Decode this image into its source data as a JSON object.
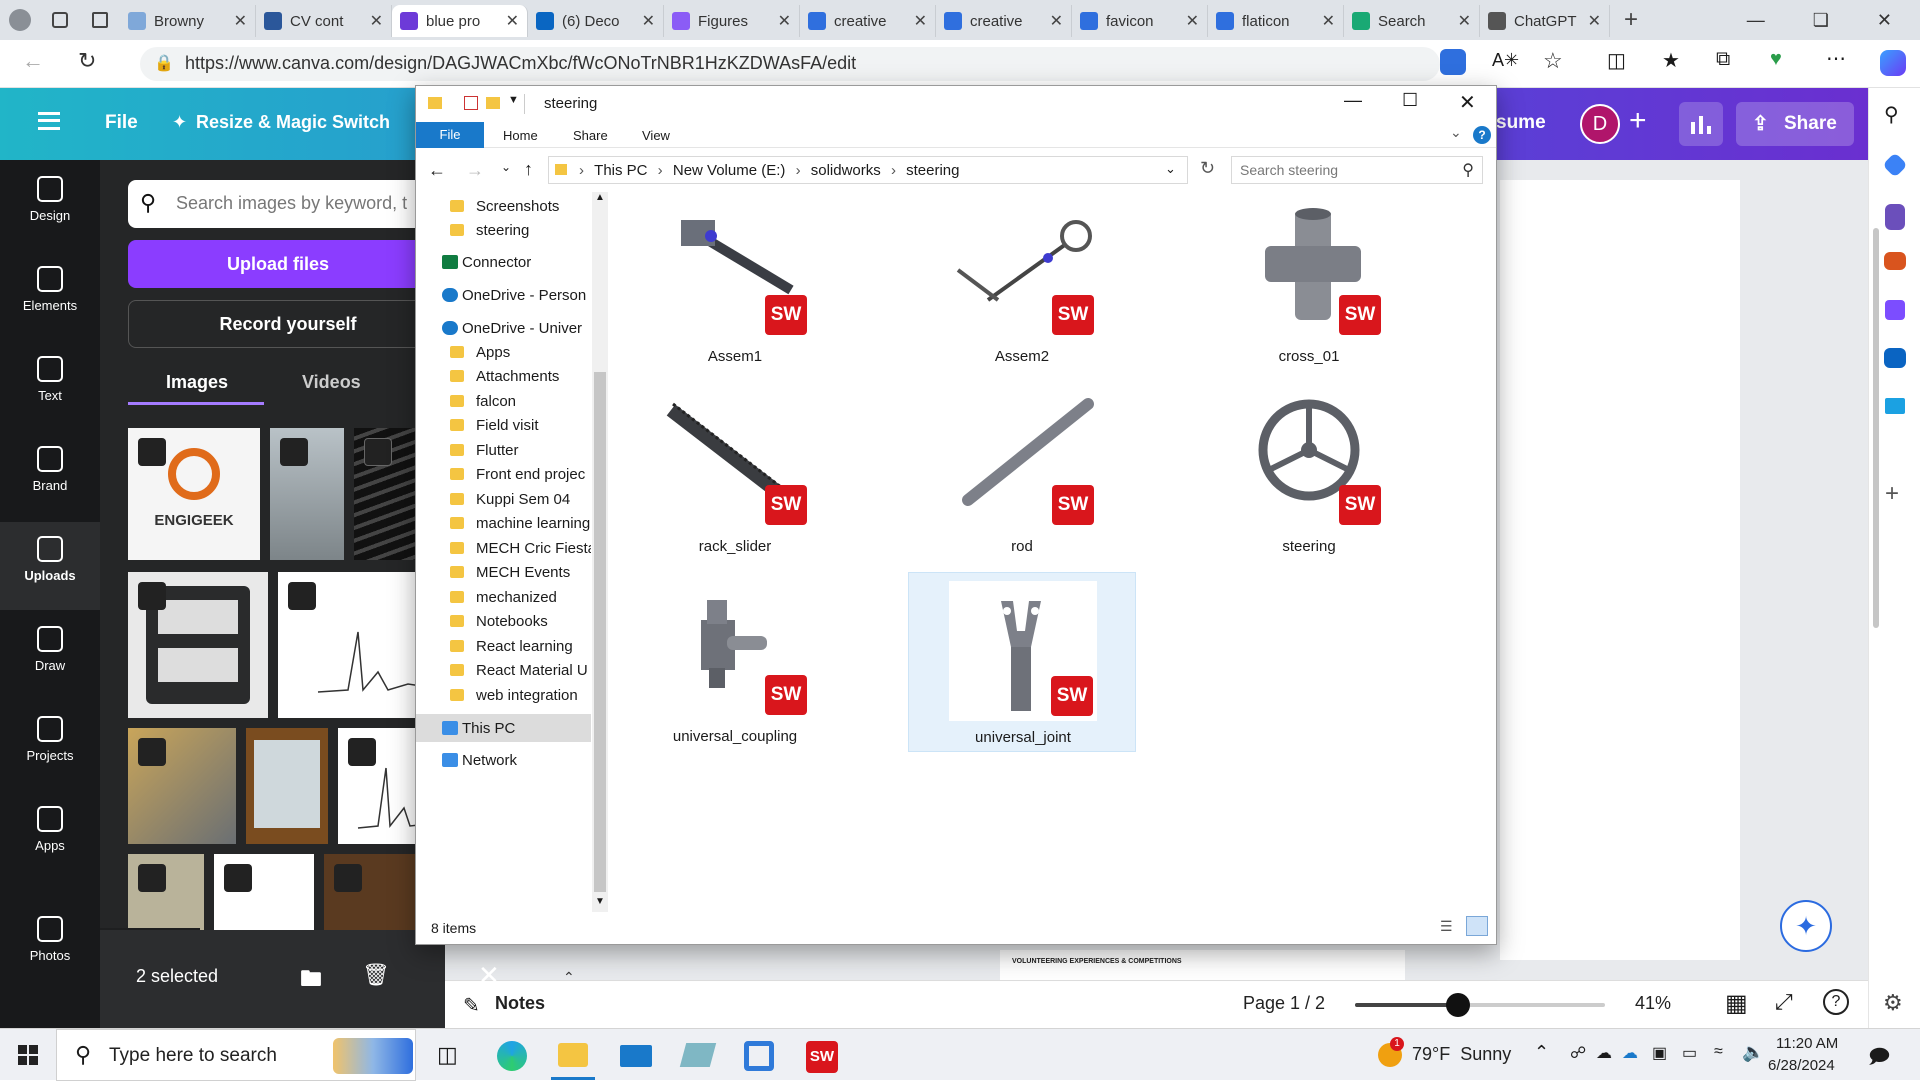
{
  "browser": {
    "tabs": [
      {
        "label": "Browny",
        "color": "#7fa8d9"
      },
      {
        "label": "CV cont",
        "color": "#2b579a"
      },
      {
        "label": "blue pro",
        "color": "#6d3ad8",
        "active": true
      },
      {
        "label": "(6) Deco",
        "color": "#0a66c2"
      },
      {
        "label": "Figures",
        "color": "#8b5cf6"
      },
      {
        "label": "creative",
        "color": "#2f6fde"
      },
      {
        "label": "creative",
        "color": "#2f6fde"
      },
      {
        "label": "favicon",
        "color": "#2f6fde"
      },
      {
        "label": "flaticon",
        "color": "#2f6fde"
      },
      {
        "label": "Search",
        "color": "#19a974"
      },
      {
        "label": "ChatGPT",
        "color": "#555555"
      }
    ],
    "url": "https://www.canva.com/design/DAGJWACmXbc/fWcONoTrNBR1HzKZDWAsFA/edit"
  },
  "canva": {
    "file_label": "File",
    "resize_label": "Resize & Magic Switch",
    "resume_label": "sume",
    "avatar": "D",
    "share_label": "Share",
    "nav": [
      "Design",
      "Elements",
      "Text",
      "Brand",
      "Uploads",
      "Draw",
      "Projects",
      "Apps",
      "Photos"
    ],
    "search_placeholder": "Search images by keyword, t",
    "upload_label": "Upload files",
    "record_label": "Record yourself",
    "tab_images": "Images",
    "tab_videos": "Videos",
    "engigeek_text": "ENGIGEEK",
    "selected_text": "2 selected",
    "canvas_snippet": "VOLUNTEERING EXPERIENCES & COMPETITIONS",
    "notes_label": "Notes",
    "page_label": "Page 1 / 2",
    "zoom_label": "41%",
    "zoom_level": 0.41
  },
  "explorer": {
    "title": "steering",
    "ribbon": [
      "File",
      "Home",
      "Share",
      "View"
    ],
    "breadcrumb": [
      "This PC",
      "New Volume (E:)",
      "solidworks",
      "steering"
    ],
    "search_placeholder": "Search steering",
    "nav_items": [
      "Screenshots",
      "steering",
      "Connector",
      "OneDrive - Person",
      "OneDrive - Univer",
      "Apps",
      "Attachments",
      "falcon",
      "Field visit",
      "Flutter",
      "Front end projec",
      "Kuppi Sem 04",
      "machine learning",
      "MECH Cric Fiesta",
      "MECH Events",
      "mechanized",
      "Notebooks",
      "React learning",
      "React Material U",
      "web integration",
      "This PC",
      "Network"
    ],
    "files": [
      "Assem1",
      "Assem2",
      "cross_01",
      "rack_slider",
      "rod",
      "steering",
      "universal_coupling",
      "universal_joint"
    ],
    "sw_badge": "SW",
    "status": "8 items"
  },
  "taskbar": {
    "search_placeholder": "Type here to search",
    "weather": "79°F  Sunny",
    "time": "11:20 AM",
    "date": "6/28/2024",
    "weather_badge": "1"
  }
}
